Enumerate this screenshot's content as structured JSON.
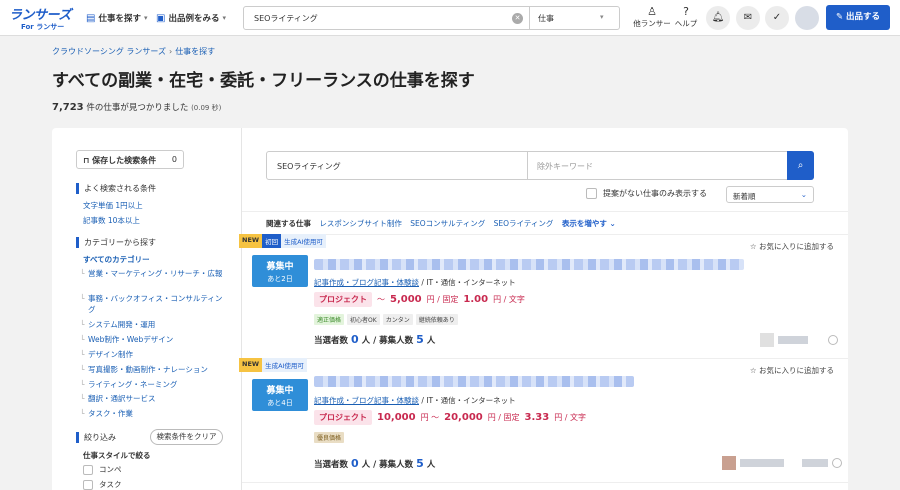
{
  "header": {
    "logo": "ランサーズ",
    "logo_sub": "For ランサー",
    "nav": [
      {
        "label": "仕事を探す",
        "icon": "document-icon"
      },
      {
        "label": "出品例をみる",
        "icon": "bag-icon"
      }
    ],
    "search": {
      "query": "SEOライティング",
      "category": "仕事"
    },
    "links": [
      {
        "label": "他ランサー",
        "icon": "person-icon"
      },
      {
        "label": "ヘルプ",
        "icon": "help-icon"
      }
    ],
    "icons": [
      "bell-icon",
      "mail-icon",
      "clipboard-icon"
    ],
    "post_label": "出品する"
  },
  "breadcrumb": [
    "クラウドソーシング ランサーズ",
    "仕事を探す"
  ],
  "page_title": "すべての副業・在宅・委託・フリーランスの仕事を探す",
  "result": {
    "count": "7,723",
    "text": "件の仕事が見つかりました",
    "time": "(0.09 秒)"
  },
  "sidebar": {
    "saved_label": "保存した検索条件",
    "saved_count": "0",
    "frequent_title": "よく検索される条件",
    "frequent": [
      "文字単価 1円以上",
      "記事数 10本以上"
    ],
    "category_title": "カテゴリーから探す",
    "all_categories": "すべてのカテゴリー",
    "categories": [
      "営業・マーケティング・リサーチ・広報",
      "事務・バックオフィス・コンサルティング",
      "システム開発・運用",
      "Web制作・Webデザイン",
      "デザイン制作",
      "写真撮影・動画制作・ナレーション",
      "ライティング・ネーミング",
      "翻訳・通訳サービス",
      "タスク・作業"
    ],
    "filter_title": "絞り込み",
    "clear_label": "検索条件をクリア",
    "style_title": "仕事スタイルで絞る",
    "styles": [
      "コンペ",
      "タスク"
    ]
  },
  "main": {
    "keyword": "SEOライティング",
    "exclude_placeholder": "除外キーワード",
    "no_proposal_label": "提案がない仕事のみ表示する",
    "sort": "新着順",
    "related_title": "関連する仕事",
    "related": [
      "レスポンシブサイト制作",
      "SEOコンサルティング",
      "SEOライティング"
    ],
    "more_label": "表示を増やす"
  },
  "jobs": [
    {
      "tags": [
        "NEW",
        "初回",
        "生成AI使用可"
      ],
      "fav": "お気に入りに追加する",
      "status": "募集中",
      "remaining": "あと2日",
      "category": "記事作成・ブログ記事・体験談",
      "industry": "IT・通信・インターネット",
      "type": "プロジェクト",
      "price_low": "5,000",
      "price_high": "",
      "fixed": "1.00",
      "features": [
        "適正価格",
        "初心者OK",
        "カンタン",
        "継続依頼あり"
      ],
      "winners": "0",
      "recruits": "5",
      "winners_label": "当選者数",
      "recruits_label": "募集人数",
      "unit": "人"
    },
    {
      "tags": [
        "NEW",
        "",
        "生成AI使用可"
      ],
      "fav": "お気に入りに追加する",
      "status": "募集中",
      "remaining": "あと4日",
      "category": "記事作成・ブログ記事・体験談",
      "industry": "IT・通信・インターネット",
      "type": "プロジェクト",
      "price_low": "10,000",
      "price_high": "20,000",
      "fixed": "3.33",
      "features": [
        "優良価格"
      ],
      "winners": "0",
      "recruits": "5",
      "winners_label": "当選者数",
      "recruits_label": "募集人数",
      "unit": "人"
    }
  ],
  "colors": {
    "brand": "#1f5ec9",
    "price": "#c8294f",
    "badge": "#2f8ed8",
    "new_tag": "#f6c342"
  }
}
